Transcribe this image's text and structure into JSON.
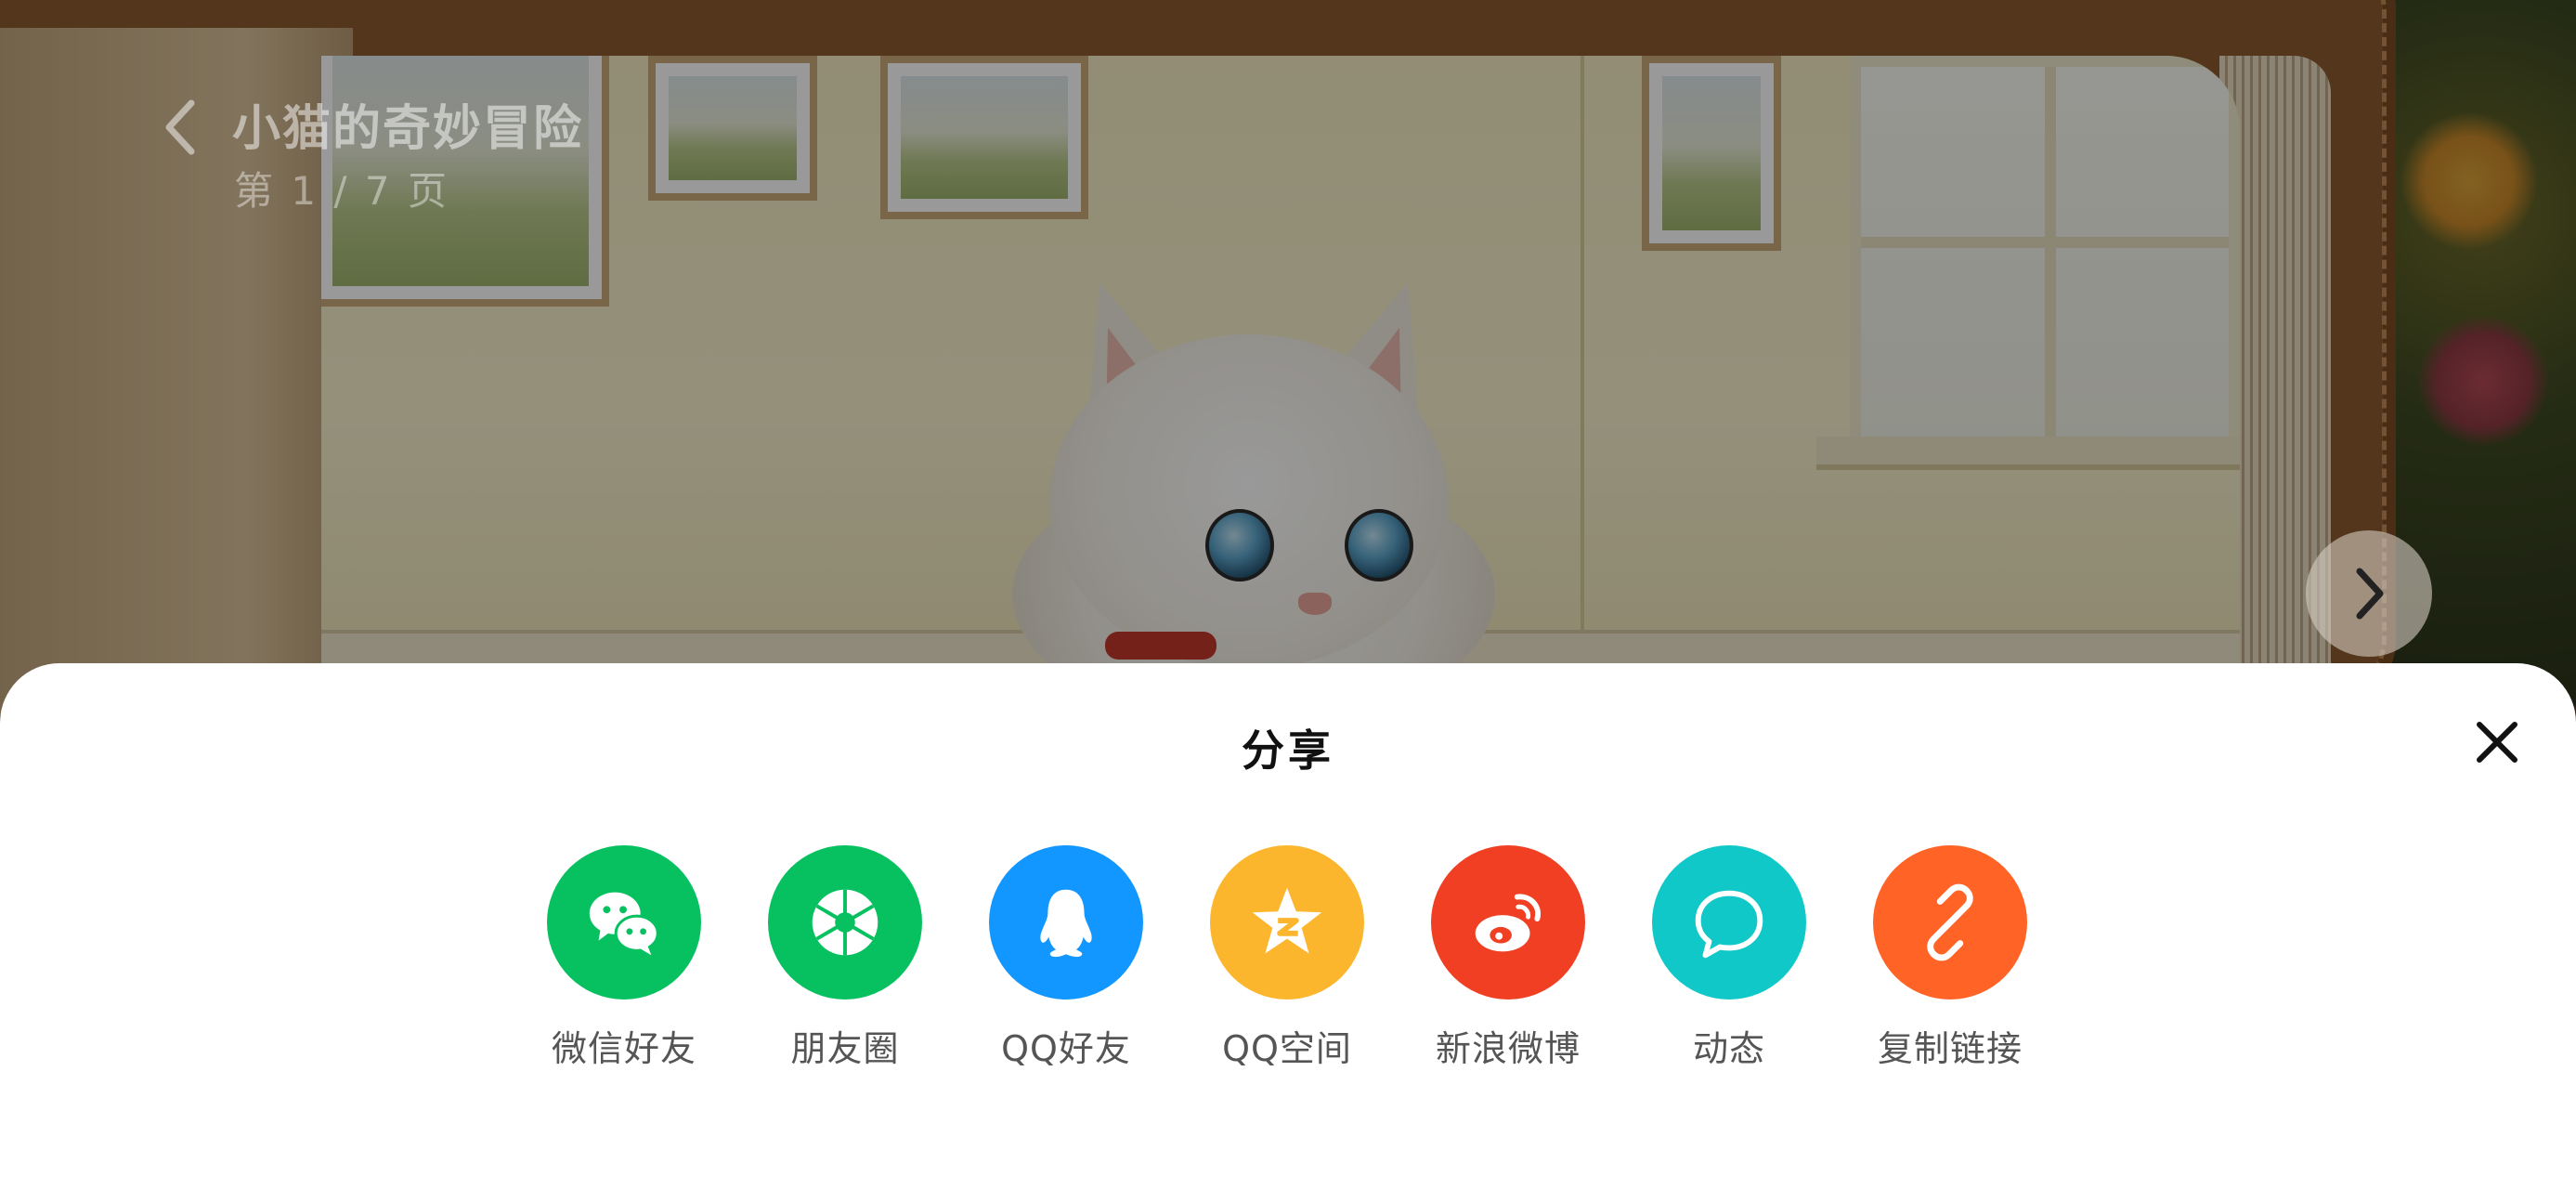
{
  "header": {
    "title": "小猫的奇妙冒险",
    "page_indicator": "第 1 / 7 页",
    "back_icon": "chevron-left-icon",
    "next_icon": "chevron-right-icon"
  },
  "share_sheet": {
    "title": "分享",
    "close_icon": "close-icon",
    "items": [
      {
        "label": "微信好友",
        "icon": "wechat-icon",
        "color": "#07C160"
      },
      {
        "label": "朋友圈",
        "icon": "moments-icon",
        "color": "#07C160"
      },
      {
        "label": "QQ好友",
        "icon": "qq-icon",
        "color": "#1296FF"
      },
      {
        "label": "QQ空间",
        "icon": "qzone-icon",
        "color": "#FBB62D"
      },
      {
        "label": "新浪微博",
        "icon": "weibo-icon",
        "color": "#F03F22"
      },
      {
        "label": "动态",
        "icon": "chat-bubble-icon",
        "color": "#10C8C8"
      },
      {
        "label": "复制链接",
        "icon": "link-icon",
        "color": "#FF6325"
      }
    ]
  },
  "colors": {
    "sheet_background": "#FFFFFF",
    "overlay": "rgba(0,0,0,0.40)"
  }
}
